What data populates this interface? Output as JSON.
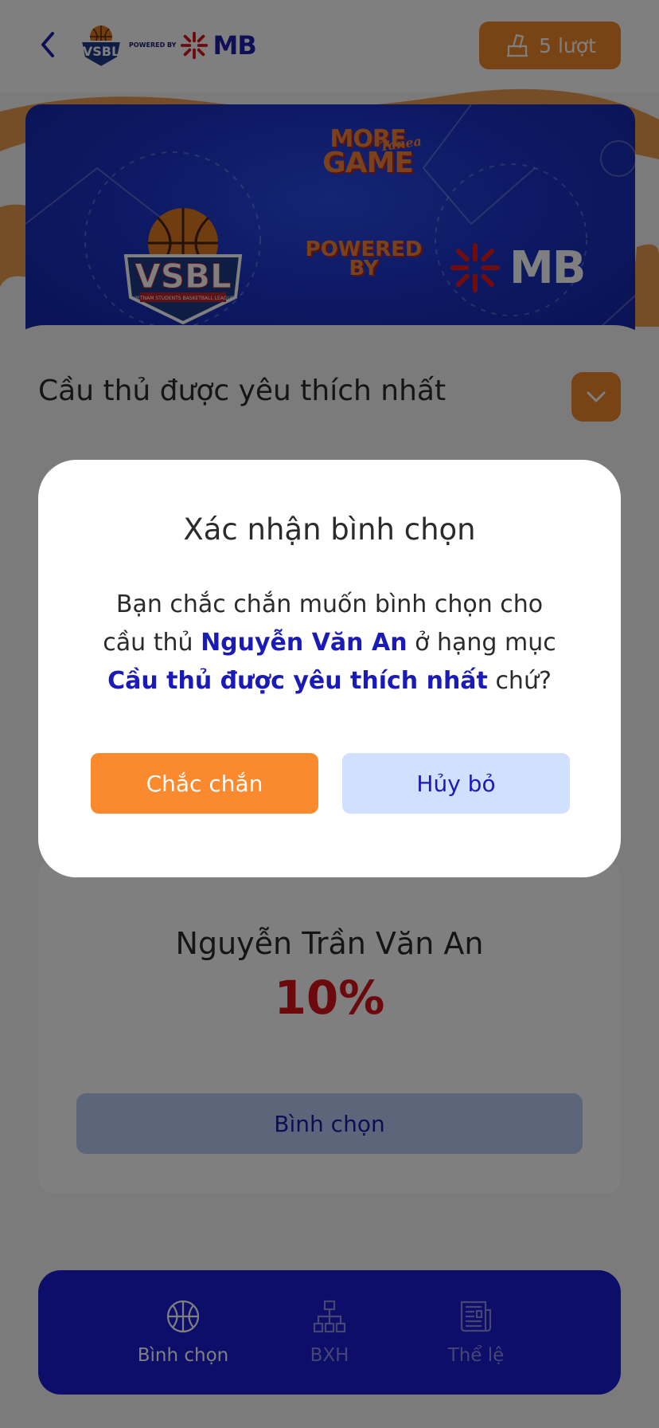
{
  "header": {
    "brand_left": "VSBL",
    "powered_by": "POWERED BY",
    "brand_right": "MB",
    "votes_label": "5 lượt"
  },
  "banner": {
    "game_title_top": "MORE",
    "game_title_bottom": "GAME",
    "game_title_script": "Tanea",
    "vsbl_text": "VSBL",
    "vsbl_ribbon": "VIETNAM STUDENTS BASKETBALL LEAGUE",
    "powered_by_line1": "POWERED",
    "powered_by_line2": "BY",
    "mb_text": "MB"
  },
  "section": {
    "title": "Cầu thủ được yêu thích nhất"
  },
  "player": {
    "name": "Nguyễn Trần Văn An",
    "percent": "10%",
    "vote_button": "Bình chọn"
  },
  "bottom_nav": {
    "items": [
      {
        "label": "Bình chọn",
        "icon": "basketball-icon",
        "active": true
      },
      {
        "label": "BXH",
        "icon": "hierarchy-icon",
        "active": false
      },
      {
        "label": "Thể lệ",
        "icon": "newspaper-icon",
        "active": false
      }
    ]
  },
  "modal": {
    "title": "Xác nhận bình chọn",
    "body_prefix": "Bạn chắc chắn muốn bình chọn cho cầu thủ ",
    "player_name": "Nguyễn Văn An",
    "body_middle": " ở hạng mục ",
    "category": "Cầu thủ được yêu thích nhất",
    "body_suffix": " chứ?",
    "confirm_label": "Chắc chắn",
    "cancel_label": "Hủy bỏ"
  },
  "colors": {
    "accent_orange": "#f0892b",
    "brand_blue": "#1a1ad4",
    "highlight_blue": "#1a1ab8",
    "percent_red": "#d8131b",
    "cancel_bg": "#d2e0ff"
  }
}
